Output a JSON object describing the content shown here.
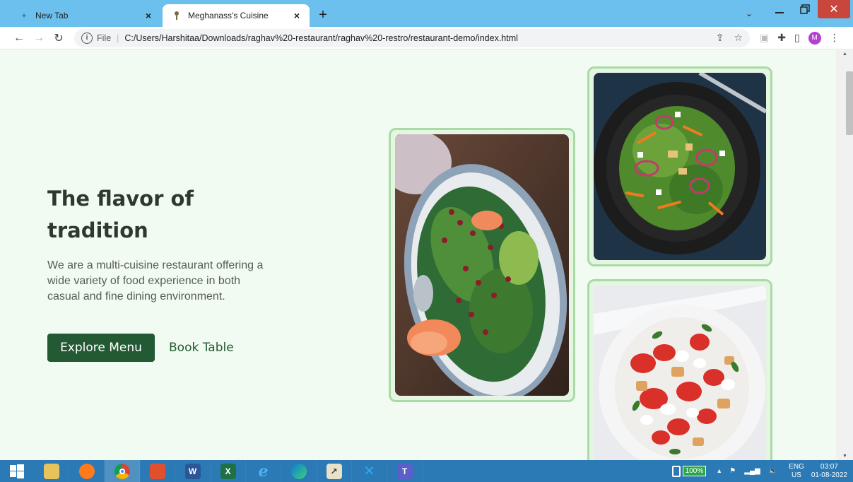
{
  "browser": {
    "tabs": [
      {
        "label": "New Tab"
      },
      {
        "label": "Meghanass's Cuisine"
      }
    ],
    "address": {
      "scheme": "File",
      "url": "C:/Users/Harshitaa/Downloads/raghav%20-restaurant/raghav%20-restro/restaurant-demo/index.html"
    },
    "profile_initial": "M",
    "window_controls": [
      "minimize",
      "maximize",
      "close"
    ]
  },
  "hero": {
    "title": "The flavor of tradition",
    "description": "We are a multi-cuisine restaurant offering a wide variety of food experience in both casual and fine dining environment.",
    "primary_button": "Explore Menu",
    "secondary_button": "Book Table"
  },
  "gallery": {
    "images": [
      "salad-plate-photo",
      "dark-plate-salad-photo",
      "tomato-salad-photo"
    ]
  },
  "taskbar": {
    "apps": [
      "file-explorer",
      "firefox",
      "chrome",
      "app",
      "word",
      "excel",
      "internet-explorer",
      "edge",
      "app",
      "vscode",
      "teams"
    ],
    "battery": "100%",
    "language": {
      "line1": "ENG",
      "line2": "US"
    },
    "time": "03:07",
    "date": "01-08-2022"
  },
  "colors": {
    "page_bg": "#f2fbf2",
    "primary": "#235a33",
    "frame_border": "#a9dba4",
    "tabstrip": "#6cc0ee",
    "taskbar": "#2b79b5"
  }
}
